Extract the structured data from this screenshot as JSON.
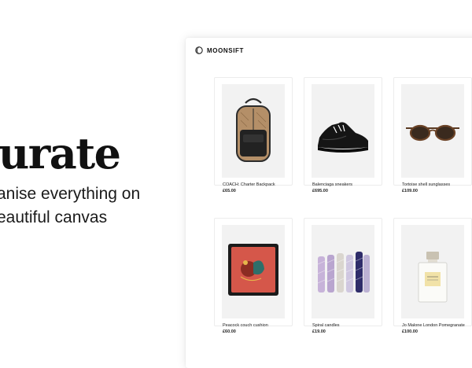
{
  "hero": {
    "title": "urate",
    "subtitle_line1": "anise everything on",
    "subtitle_line2": "eautiful canvas"
  },
  "app": {
    "brand": "MOONSIFT",
    "logo_icon": "moon-icon",
    "products": [
      {
        "name": "COACH: Charter Backpack",
        "price": "£65.00",
        "image": "backpack-image"
      },
      {
        "name": "Balenciaga sneakers",
        "price": "£695.00",
        "image": "sneaker-image"
      },
      {
        "name": "Tortoise shell sunglasses",
        "price": "£109.00",
        "image": "sunglasses-image"
      },
      {
        "name": "Peacock couch cushion",
        "price": "£60.00",
        "image": "cushion-image"
      },
      {
        "name": "Spiral candles",
        "price": "£19.00",
        "image": "candles-image"
      },
      {
        "name": "Jo Malone London Pomegranate",
        "price": "£100.00",
        "image": "perfume-image"
      }
    ]
  },
  "colors": {
    "text": "#111111",
    "card_border": "#ececec",
    "image_bg": "#f2f2f2",
    "cushion_red": "#d5574a"
  }
}
